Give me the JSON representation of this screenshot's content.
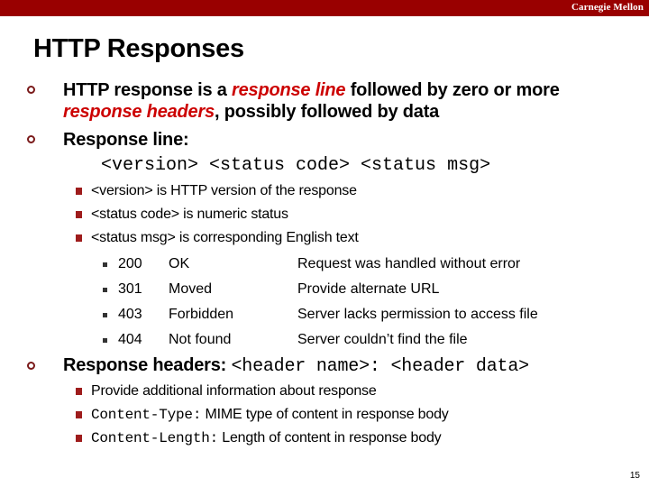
{
  "header": {
    "brand": "Carnegie Mellon"
  },
  "slide": {
    "title": "HTTP Responses",
    "bullets": [
      {
        "parts": [
          {
            "text": "HTTP response is a ",
            "style": "normal"
          },
          {
            "text": "response line",
            "style": "emph"
          },
          {
            "text": " followed by zero or more",
            "style": "normal"
          }
        ],
        "parts2": [
          {
            "text": "response headers",
            "style": "emph"
          },
          {
            "text": ", possibly followed by data",
            "style": "normal"
          }
        ]
      },
      {
        "label": "Response line:",
        "code": "<version> <status code> <status msg>",
        "sub": [
          "<version> is HTTP version of the response",
          "<status code> is numeric status",
          "<status msg> is corresponding English text"
        ],
        "status_codes": [
          {
            "code": "200",
            "msg": "OK",
            "desc": "Request was handled without error"
          },
          {
            "code": "301",
            "msg": "Moved",
            "desc": "Provide alternate URL"
          },
          {
            "code": "403",
            "msg": "Forbidden",
            "desc": "Server lacks permission to access file"
          },
          {
            "code": "404",
            "msg": "Not found",
            "desc": "Server couldn’t find the file"
          }
        ]
      },
      {
        "label": "Response headers: ",
        "code": "<header name>: <header data>",
        "sub": [
          {
            "code": "",
            "text": "Provide additional information about response"
          },
          {
            "code": "Content-Type:",
            "text": " MIME type of content in response body"
          },
          {
            "code": "Content-Length:",
            "text": " Length of content in response body"
          }
        ]
      }
    ]
  },
  "footer": {
    "page_number": "15"
  },
  "colors": {
    "brand_bar": "#990000",
    "emphasis": "#cc0000",
    "bullet": "#9e1c1c"
  }
}
